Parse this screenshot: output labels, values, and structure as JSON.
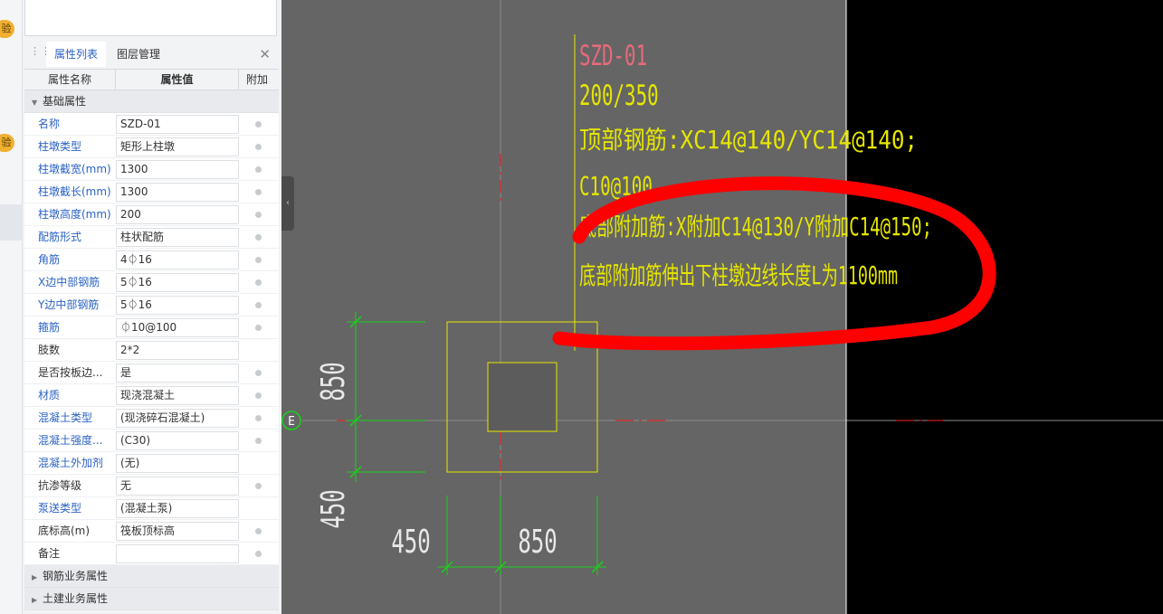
{
  "left_strip": {
    "badge1": "验",
    "badge2": "验"
  },
  "panel": {
    "tabs": {
      "properties": "属性列表",
      "layers": "图层管理"
    },
    "close_icon": "close-icon",
    "columns": {
      "name": "属性名称",
      "value": "属性值",
      "extra": "附加"
    },
    "group_basic": "基础属性",
    "rows": [
      {
        "label": "名称",
        "value": "SZD-01"
      },
      {
        "label": "柱墩类型",
        "value": "矩形上柱墩"
      },
      {
        "label": "柱墩截宽(mm)",
        "value": "1300"
      },
      {
        "label": "柱墩截长(mm)",
        "value": "1300"
      },
      {
        "label": "柱墩高度(mm)",
        "value": "200"
      },
      {
        "label": "配筋形式",
        "value": "柱状配筋"
      },
      {
        "label": "角筋",
        "value": "4⏀16"
      },
      {
        "label": "X边中部钢筋",
        "value": "5⏀16"
      },
      {
        "label": "Y边中部钢筋",
        "value": "5⏀16"
      },
      {
        "label": "箍筋",
        "value": "⏀10@100"
      },
      {
        "label": "肢数",
        "value": "2*2"
      },
      {
        "label": "是否按板边...",
        "value": "是"
      },
      {
        "label": "材质",
        "value": "现浇混凝土"
      },
      {
        "label": "混凝土类型",
        "value": "(现浇碎石混凝土)"
      },
      {
        "label": "混凝土强度...",
        "value": "(C30)"
      },
      {
        "label": "混凝土外加剂",
        "value": "(无)"
      },
      {
        "label": "抗渗等级",
        "value": "无"
      },
      {
        "label": "泵送类型",
        "value": "(混凝土泵)"
      },
      {
        "label": "底标高(m)",
        "value": "筏板顶标高"
      },
      {
        "label": "备注",
        "value": ""
      }
    ],
    "group_rebar": "钢筋业务属性",
    "group_civil": "土建业务属性"
  },
  "cad": {
    "annotation": {
      "name": "SZD-01",
      "height": "200/350",
      "top_rebar": "顶部钢筋:XC14@140/YC14@140;",
      "stirrup": "C10@100",
      "bottom_extra": "底部附加筋:X附加C14@130/Y附加C14@150;",
      "extension": "底部附加筋伸出下柱墩边线长度L为1100mm"
    },
    "dims": {
      "d850_v": "850",
      "d450_v": "450",
      "d450_h": "450",
      "d850_h": "850"
    },
    "axis_label": "E",
    "colors": {
      "gray_bg": "#656565",
      "black_bg": "#000000",
      "yellow": "#e6e600",
      "green": "#19d319",
      "red_mark": "#ff2020",
      "pink": "#e86a7a"
    }
  }
}
